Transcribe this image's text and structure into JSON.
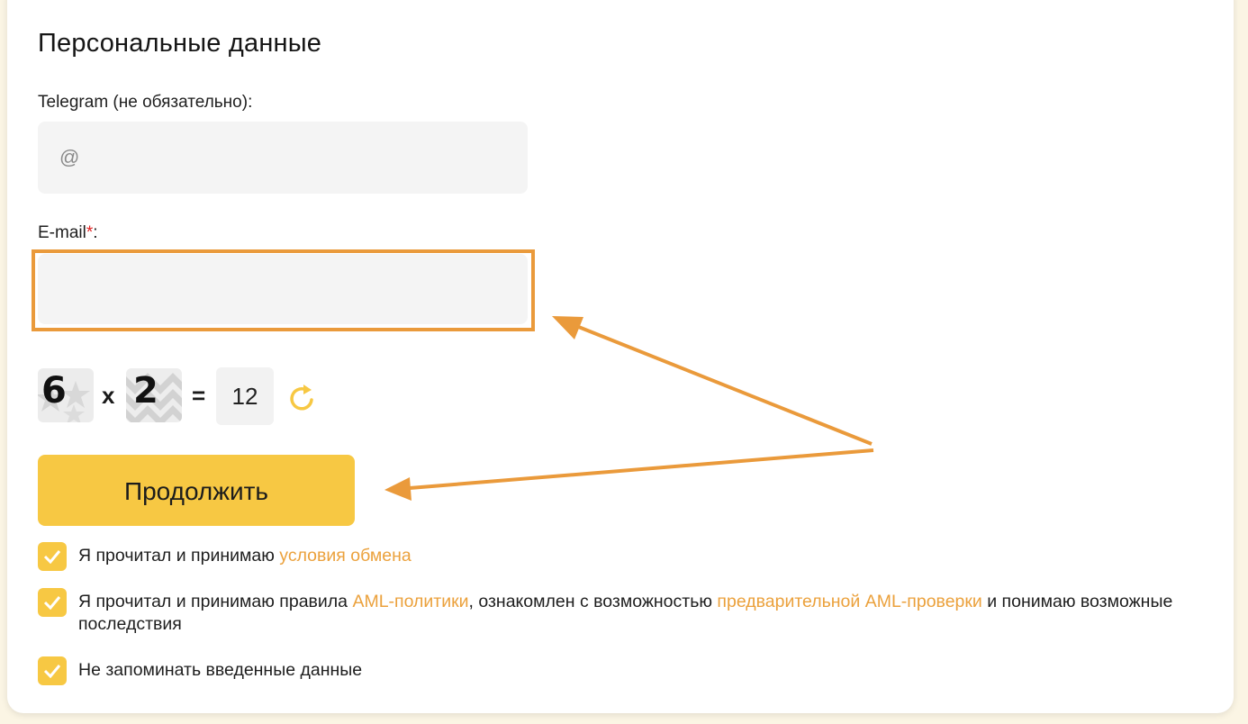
{
  "form": {
    "title": "Персональные данные",
    "telegram_label": "Telegram (не обязательно):",
    "telegram_placeholder": "@",
    "email_label": "E-mail",
    "email_required_mark": "*",
    "email_label_suffix": ":",
    "email_value": ""
  },
  "captcha": {
    "first_digit": "6",
    "operator": "x",
    "second_digit": "2",
    "equals": "=",
    "answer": "12",
    "refresh_icon": "refresh-icon"
  },
  "continue_button": {
    "label": "Продолжить"
  },
  "checkboxes": [
    {
      "checked": true,
      "text_before": "Я прочитал и принимаю ",
      "link1": "условия обмена"
    },
    {
      "checked": true,
      "text_before": "Я прочитал и принимаю правила ",
      "link1": "AML-политики",
      "text_middle": ", ознакомлен с возможностью ",
      "link2": "предварительной AML-проверки",
      "text_after": " и понимаю возможные последствия"
    },
    {
      "checked": true,
      "text_before": "Не запоминать введенные данные"
    }
  ],
  "colors": {
    "accent": "#f7c843",
    "link": "#eba13c",
    "annotation": "#ea9a3b",
    "required": "#e02020"
  }
}
